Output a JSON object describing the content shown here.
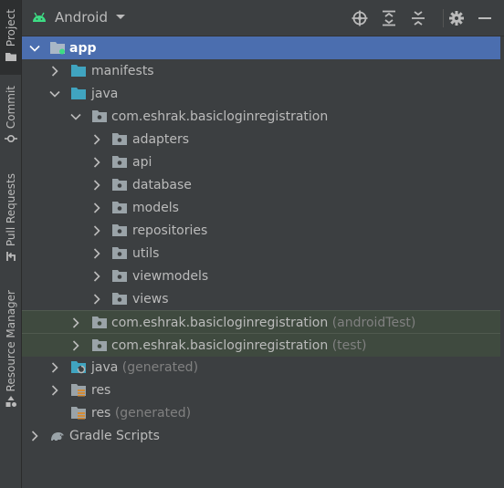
{
  "side_tabs": {
    "project": "Project",
    "commit": "Commit",
    "pull_requests": "Pull Requests",
    "resource_manager": "Resource Manager"
  },
  "toolbar": {
    "view_mode": "Android",
    "icons": [
      "locate-icon",
      "expand-all-icon",
      "collapse-all-icon",
      "gear-icon",
      "minimize-icon"
    ]
  },
  "colors": {
    "background": "#3c3f41",
    "selection": "#4b6eaf",
    "test_highlight": "#3f4a3f",
    "folder_teal": "#40a4c0",
    "package_gray": "#9aa3a8",
    "muted_text": "#808080"
  },
  "tree": {
    "app": "app",
    "manifests": "manifests",
    "java": "java",
    "main_package": "com.eshrak.basicloginregistration",
    "packages": [
      "adapters",
      "api",
      "database",
      "models",
      "repositories",
      "utils",
      "viewmodels",
      "views"
    ],
    "android_test_package": "com.eshrak.basicloginregistration",
    "android_test_suffix": "(androidTest)",
    "test_package": "com.eshrak.basicloginregistration",
    "test_suffix": "(test)",
    "java_generated": "java",
    "java_generated_suffix": "(generated)",
    "res": "res",
    "res_generated": "res",
    "res_generated_suffix": "(generated)",
    "gradle_scripts": "Gradle Scripts"
  }
}
